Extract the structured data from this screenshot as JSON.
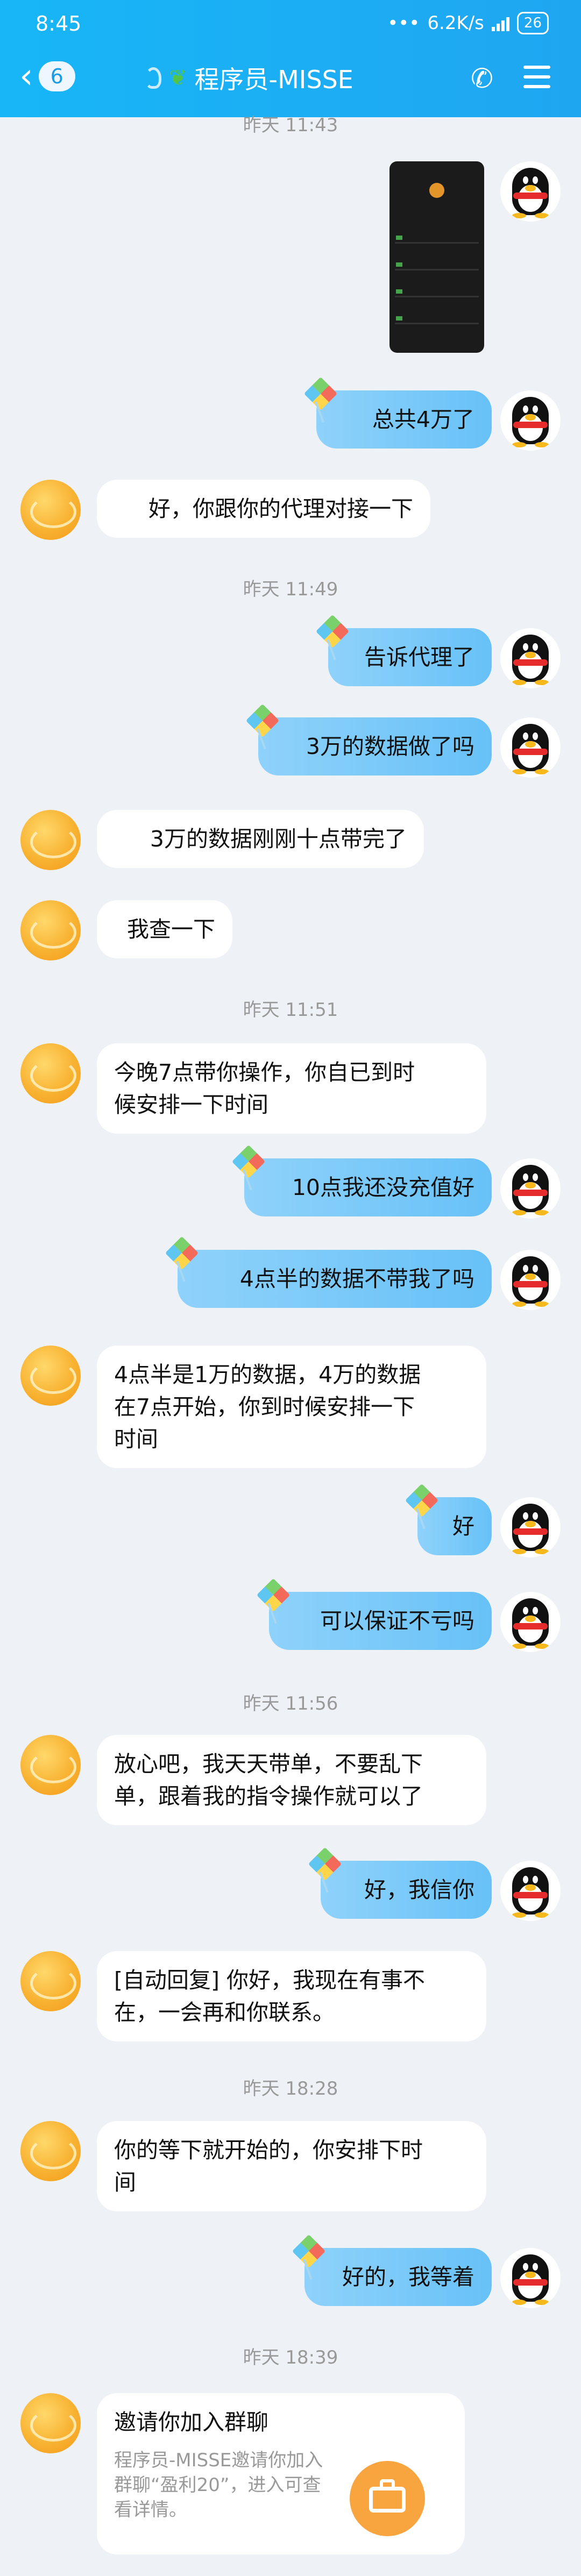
{
  "status_bar": {
    "time": "8:45",
    "speed": "6.2K/s",
    "battery": "26"
  },
  "header": {
    "back_count": "6",
    "title": "程序员-MISSE",
    "title_icon": "sprout-icon"
  },
  "messages": [
    {
      "type": "timestamp",
      "text": "昨天 11:43"
    },
    {
      "type": "image",
      "side": "out"
    },
    {
      "type": "text",
      "side": "out",
      "text": "总共4万了"
    },
    {
      "type": "text",
      "side": "in",
      "text": "好，你跟你的代理对接一下"
    },
    {
      "type": "timestamp",
      "text": "昨天 11:49"
    },
    {
      "type": "text",
      "side": "out",
      "text": "告诉代理了"
    },
    {
      "type": "text",
      "side": "out",
      "text": "3万的数据做了吗"
    },
    {
      "type": "text",
      "side": "in",
      "text": "3万的数据刚刚十点带完了"
    },
    {
      "type": "text",
      "side": "in",
      "text": "我查一下"
    },
    {
      "type": "timestamp",
      "text": "昨天 11:51"
    },
    {
      "type": "text",
      "side": "in",
      "lines": [
        "今晚7点带你操作，你自已到时",
        "候安排一下时间"
      ]
    },
    {
      "type": "text",
      "side": "out",
      "text": "10点我还没充值好"
    },
    {
      "type": "text",
      "side": "out",
      "text": "4点半的数据不带我了吗"
    },
    {
      "type": "text",
      "side": "in",
      "lines": [
        "4点半是1万的数据，4万的数据",
        "在7点开始，你到时候安排一下",
        "时间"
      ]
    },
    {
      "type": "text",
      "side": "out",
      "text": "好"
    },
    {
      "type": "text",
      "side": "out",
      "text": "可以保证不亏吗"
    },
    {
      "type": "timestamp",
      "text": "昨天 11:56"
    },
    {
      "type": "text",
      "side": "in",
      "lines": [
        "放心吧，我天天带单，不要乱下",
        "单，跟着我的指令操作就可以了"
      ]
    },
    {
      "type": "text",
      "side": "out",
      "text": "好，我信你"
    },
    {
      "type": "text",
      "side": "in",
      "lines": [
        "[自动回复] 你好，我现在有事不",
        "在，一会再和你联系。"
      ]
    },
    {
      "type": "timestamp",
      "text": "昨天 18:28"
    },
    {
      "type": "text",
      "side": "in",
      "lines": [
        "你的等下就开始的，你安排下时",
        "间"
      ]
    },
    {
      "type": "text",
      "side": "out",
      "text": "好的，我等着"
    },
    {
      "type": "timestamp",
      "text": "昨天 18:39"
    },
    {
      "type": "card",
      "side": "in",
      "title": "邀请你加入群聊",
      "desc": [
        "程序员-MISSE邀请你加入",
        "群聊“盈利20”，进入可查",
        "看详情。"
      ]
    }
  ]
}
